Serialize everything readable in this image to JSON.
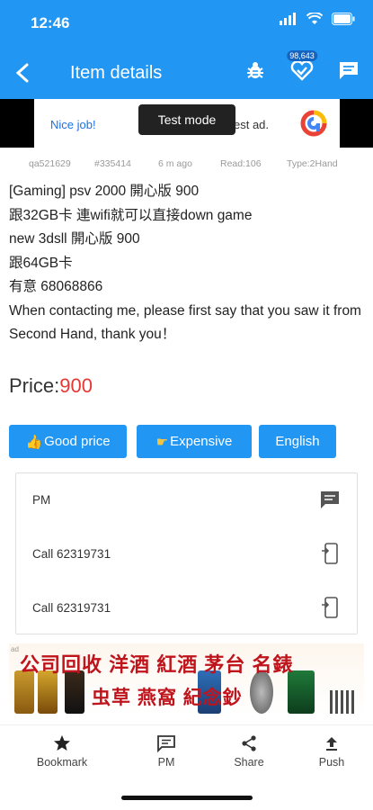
{
  "status_bar": {
    "time": "12:46"
  },
  "app_bar": {
    "title": "Item details",
    "badge_count": "98,643"
  },
  "top_ad": {
    "left_text": "Nice job!",
    "right_text": "est ad.",
    "test_mode": "Test mode"
  },
  "meta": {
    "user": "qa521629",
    "post_id": "#335414",
    "age": "6 m  ago",
    "reads": "Read:106",
    "type": "Type:2Hand"
  },
  "description": {
    "lines": [
      "[Gaming] psv 2000 開心版 900",
      "跟32GB卡 連wifi就可以直接down game",
      "new 3dsll 開心版 900",
      "跟64GB卡",
      "有意 68068866",
      "When contacting me, please first say that you saw it from Second Hand, thank you！"
    ]
  },
  "price": {
    "label": "Price:",
    "value": "900"
  },
  "buttons": {
    "good_price": "Good price",
    "expensive": "Expensive",
    "english": "English"
  },
  "contact": {
    "pm_label": "PM",
    "call_1": "Call  62319731",
    "call_2": "Call  62319731"
  },
  "bottom_ad": {
    "tag": "ad",
    "line1": "公司回收 洋酒 紅酒 茅台 名錶",
    "line2": "虫草 燕窩 紀念鈔"
  },
  "bottom_nav": {
    "bookmark": "Bookmark",
    "pm": "PM",
    "share": "Share",
    "push": "Push"
  },
  "colors": {
    "primary": "#2196f3",
    "price": "#e53935",
    "ad_red": "#c0141c"
  }
}
